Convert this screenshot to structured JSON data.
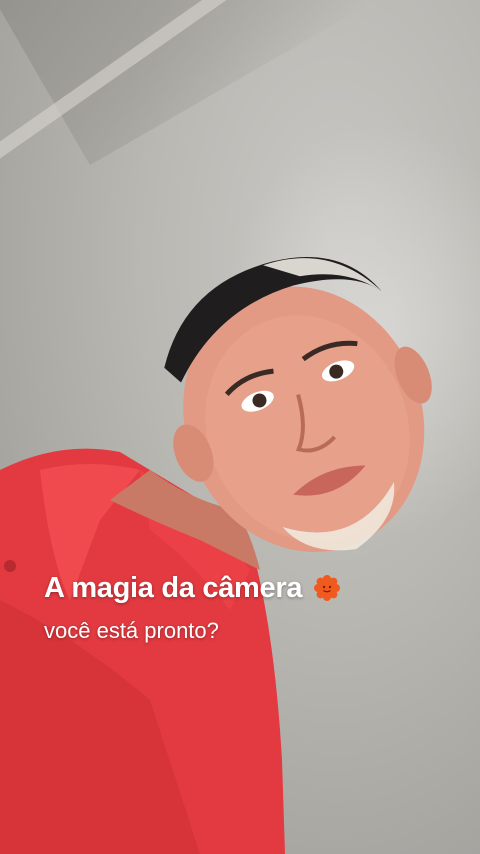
{
  "caption": {
    "title": "A magia da câmera",
    "subtitle": "você está pronto?",
    "icon": "sun-flower-icon"
  },
  "colors": {
    "shirt": "#e8383f",
    "skin": "#e59a85",
    "hair": "#1e1d1d",
    "wall": "#b9b8b3",
    "text": "#ffffff",
    "icon": "#f05a1e"
  }
}
